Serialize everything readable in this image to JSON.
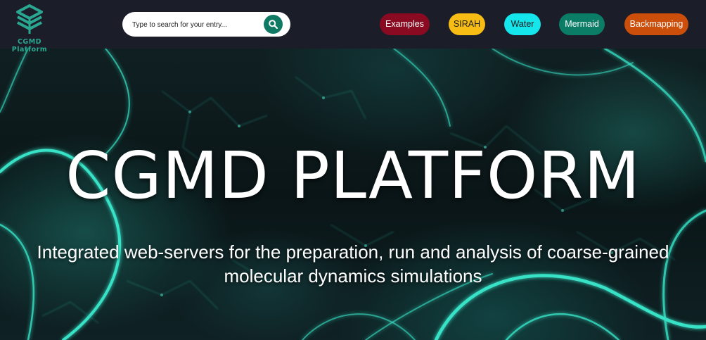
{
  "brand": {
    "name": "CGMD Platform",
    "logo_icon": "cube-stack-logo",
    "color": "#2aa791"
  },
  "search": {
    "placeholder": "Type to search for your entry...",
    "value": "",
    "button_icon": "search-icon",
    "button_color": "#0f7a64"
  },
  "nav": {
    "links": [
      {
        "label": "Examples",
        "bg": "#8a0a22",
        "fg": "#ffffff"
      },
      {
        "label": "SIRAH",
        "bg": "#f7bd14",
        "fg": "#1a1a1a"
      },
      {
        "label": "Water",
        "bg": "#14e6ec",
        "fg": "#1a1a1a"
      },
      {
        "label": "Mermaid",
        "bg": "#0b7d67",
        "fg": "#ffffff"
      },
      {
        "label": "Backmapping",
        "bg": "#cc4e0b",
        "fg": "#ffffff"
      }
    ]
  },
  "hero": {
    "title": "CGMD PLATFORM",
    "subtitle": "Integrated web-servers for the preparation, run and analysis of coarse-grained molecular dynamics simulations",
    "background": "glowing-teal-neural-network-image"
  }
}
